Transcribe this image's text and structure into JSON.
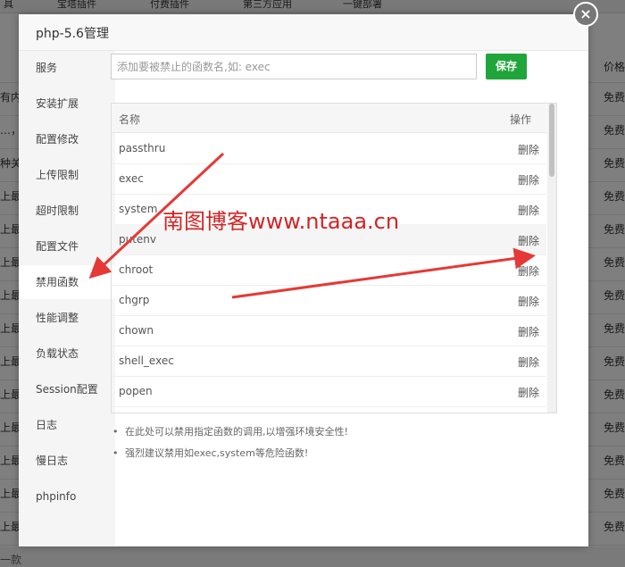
{
  "background": {
    "tabs": [
      "具",
      "宝塔插件",
      "付费插件",
      "第三方应用",
      "一键部署"
    ],
    "column_header": "价格",
    "left_fragments": [
      "有内",
      "…，",
      "种关",
      "上最",
      "上最",
      "上最",
      "上最",
      "上最",
      "上最",
      "上最",
      "上最",
      "上最",
      "上最",
      "上最",
      "一款"
    ],
    "right_values": [
      "免费",
      "免费",
      "免费",
      "免费",
      "免费",
      "免费",
      "免费",
      "免费",
      "免费",
      "免费",
      "免费",
      "免费",
      "免费",
      "免费"
    ]
  },
  "dialog": {
    "title": "php-5.6管理",
    "close_glyph": "×"
  },
  "sidebar": {
    "items": [
      "服务",
      "安装扩展",
      "配置修改",
      "上传限制",
      "超时限制",
      "配置文件",
      "禁用函数",
      "性能调整",
      "负载状态",
      "Session配置",
      "日志",
      "慢日志",
      "phpinfo"
    ],
    "active": "禁用函数"
  },
  "form": {
    "placeholder": "添加要被禁止的函数名,如: exec",
    "save_label": "保存"
  },
  "table": {
    "headers": {
      "name": "名称",
      "op": "操作"
    },
    "rows": [
      {
        "name": "passthru",
        "action": "删除"
      },
      {
        "name": "exec",
        "action": "删除"
      },
      {
        "name": "system",
        "action": "删除"
      },
      {
        "name": "putenv",
        "action": "删除"
      },
      {
        "name": "chroot",
        "action": "删除"
      },
      {
        "name": "chgrp",
        "action": "删除"
      },
      {
        "name": "chown",
        "action": "删除"
      },
      {
        "name": "shell_exec",
        "action": "删除"
      },
      {
        "name": "popen",
        "action": "删除"
      }
    ],
    "highlighted_row": "putenv"
  },
  "notes": [
    "在此处可以禁用指定函数的调用,以增强环境安全性!",
    "强烈建议禁用如exec,system等危险函数!"
  ],
  "watermark": "南图博客www.ntaaa.cn",
  "colors": {
    "accent": "#20a53a",
    "annotation_red": "#e53935"
  }
}
